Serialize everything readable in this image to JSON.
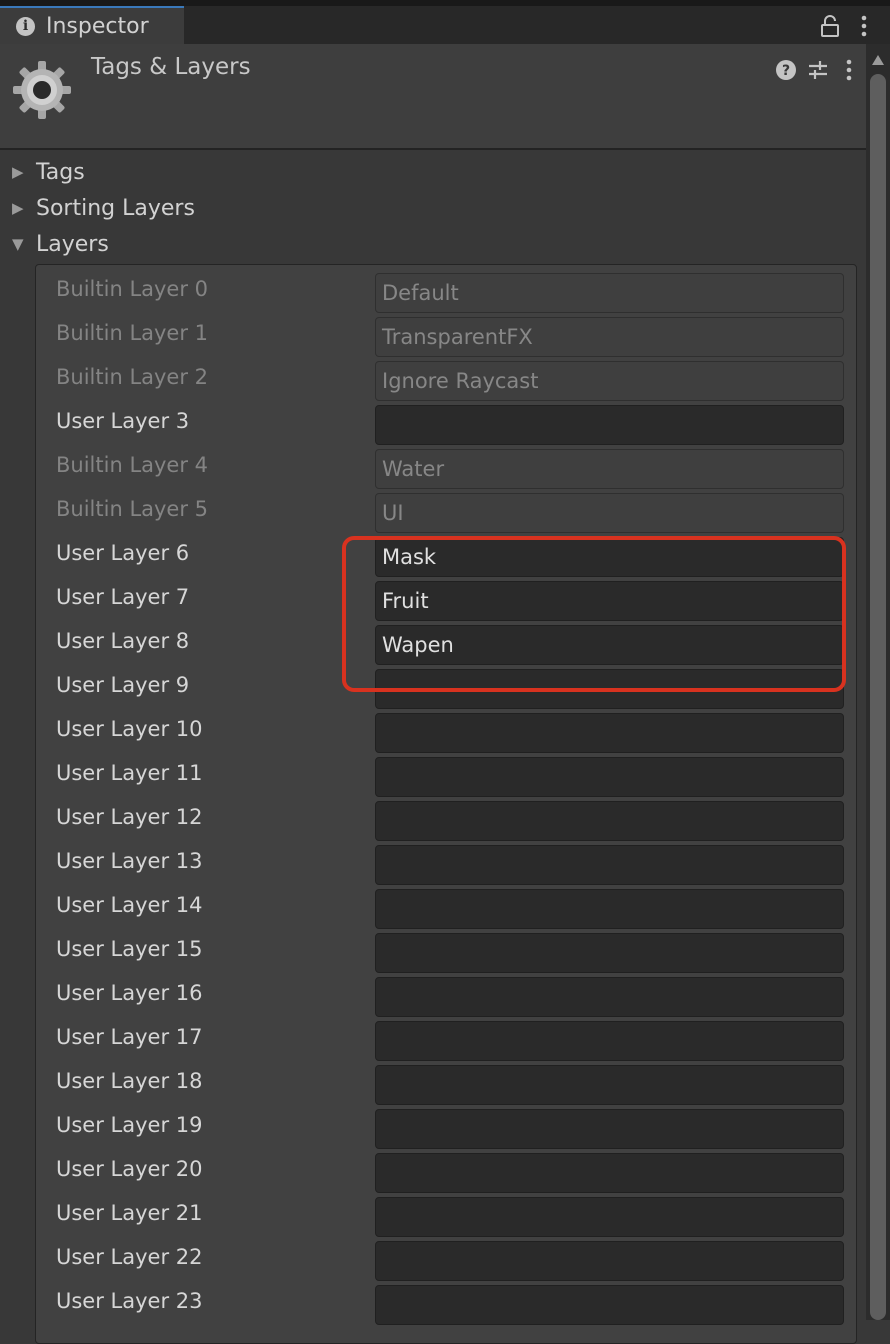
{
  "tab": {
    "title": "Inspector"
  },
  "header": {
    "title": "Tags & Layers"
  },
  "foldouts": {
    "tags": "Tags",
    "sorting_layers": "Sorting Layers",
    "layers": "Layers"
  },
  "icons": {
    "tab": "info-icon",
    "lock": "lock-icon",
    "menu": "kebab-menu-icon",
    "header": "gear-icon",
    "help": "help-icon",
    "presets": "presets-sliders-icon"
  },
  "colors": {
    "highlight": "#d8321f",
    "tab_accent": "#3a79bb",
    "background": "#383838"
  },
  "layers": [
    {
      "label": "Builtin Layer 0",
      "value": "Default",
      "builtin": true
    },
    {
      "label": "Builtin Layer 1",
      "value": "TransparentFX",
      "builtin": true
    },
    {
      "label": "Builtin Layer 2",
      "value": "Ignore Raycast",
      "builtin": true
    },
    {
      "label": "User Layer 3",
      "value": "",
      "builtin": false
    },
    {
      "label": "Builtin Layer 4",
      "value": "Water",
      "builtin": true
    },
    {
      "label": "Builtin Layer 5",
      "value": "UI",
      "builtin": true
    },
    {
      "label": "User Layer 6",
      "value": "Mask",
      "builtin": false
    },
    {
      "label": "User Layer 7",
      "value": "Fruit",
      "builtin": false
    },
    {
      "label": "User Layer 8",
      "value": "Wapen",
      "builtin": false
    },
    {
      "label": "User Layer 9",
      "value": "",
      "builtin": false
    },
    {
      "label": "User Layer 10",
      "value": "",
      "builtin": false
    },
    {
      "label": "User Layer 11",
      "value": "",
      "builtin": false
    },
    {
      "label": "User Layer 12",
      "value": "",
      "builtin": false
    },
    {
      "label": "User Layer 13",
      "value": "",
      "builtin": false
    },
    {
      "label": "User Layer 14",
      "value": "",
      "builtin": false
    },
    {
      "label": "User Layer 15",
      "value": "",
      "builtin": false
    },
    {
      "label": "User Layer 16",
      "value": "",
      "builtin": false
    },
    {
      "label": "User Layer 17",
      "value": "",
      "builtin": false
    },
    {
      "label": "User Layer 18",
      "value": "",
      "builtin": false
    },
    {
      "label": "User Layer 19",
      "value": "",
      "builtin": false
    },
    {
      "label": "User Layer 20",
      "value": "",
      "builtin": false
    },
    {
      "label": "User Layer 21",
      "value": "",
      "builtin": false
    },
    {
      "label": "User Layer 22",
      "value": "",
      "builtin": false
    },
    {
      "label": "User Layer 23",
      "value": "",
      "builtin": false
    }
  ]
}
